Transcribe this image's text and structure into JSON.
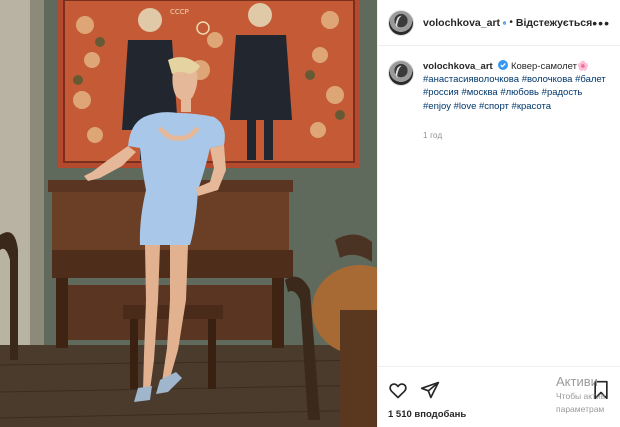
{
  "post": {
    "username": "volochkova_art",
    "follow_status": "Відстежується",
    "separator": "•",
    "more_label": "•••",
    "caption_title": "Ковер-самолет🌸",
    "hashtags": [
      "#анастасияволочкова",
      "#волочкова",
      "#балет",
      "#россия",
      "#москва",
      "#любовь",
      "#радость",
      "#enjoy",
      "#love",
      "#спорт",
      "#красота"
    ],
    "time_ago": "1 год",
    "likes": "1 510 вподобань",
    "truncated_line": "........"
  },
  "icons": {
    "verified": "verified-badge-icon",
    "like": "heart-icon",
    "share": "send-icon",
    "save": "bookmark-icon"
  },
  "colors": {
    "verified_blue": "#3897f0",
    "hashtag": "#00376b",
    "muted": "#8e8e8e"
  },
  "watermark": {
    "line1": "Активи",
    "line2": "Чтобы актив",
    "line3": "параметрам"
  }
}
